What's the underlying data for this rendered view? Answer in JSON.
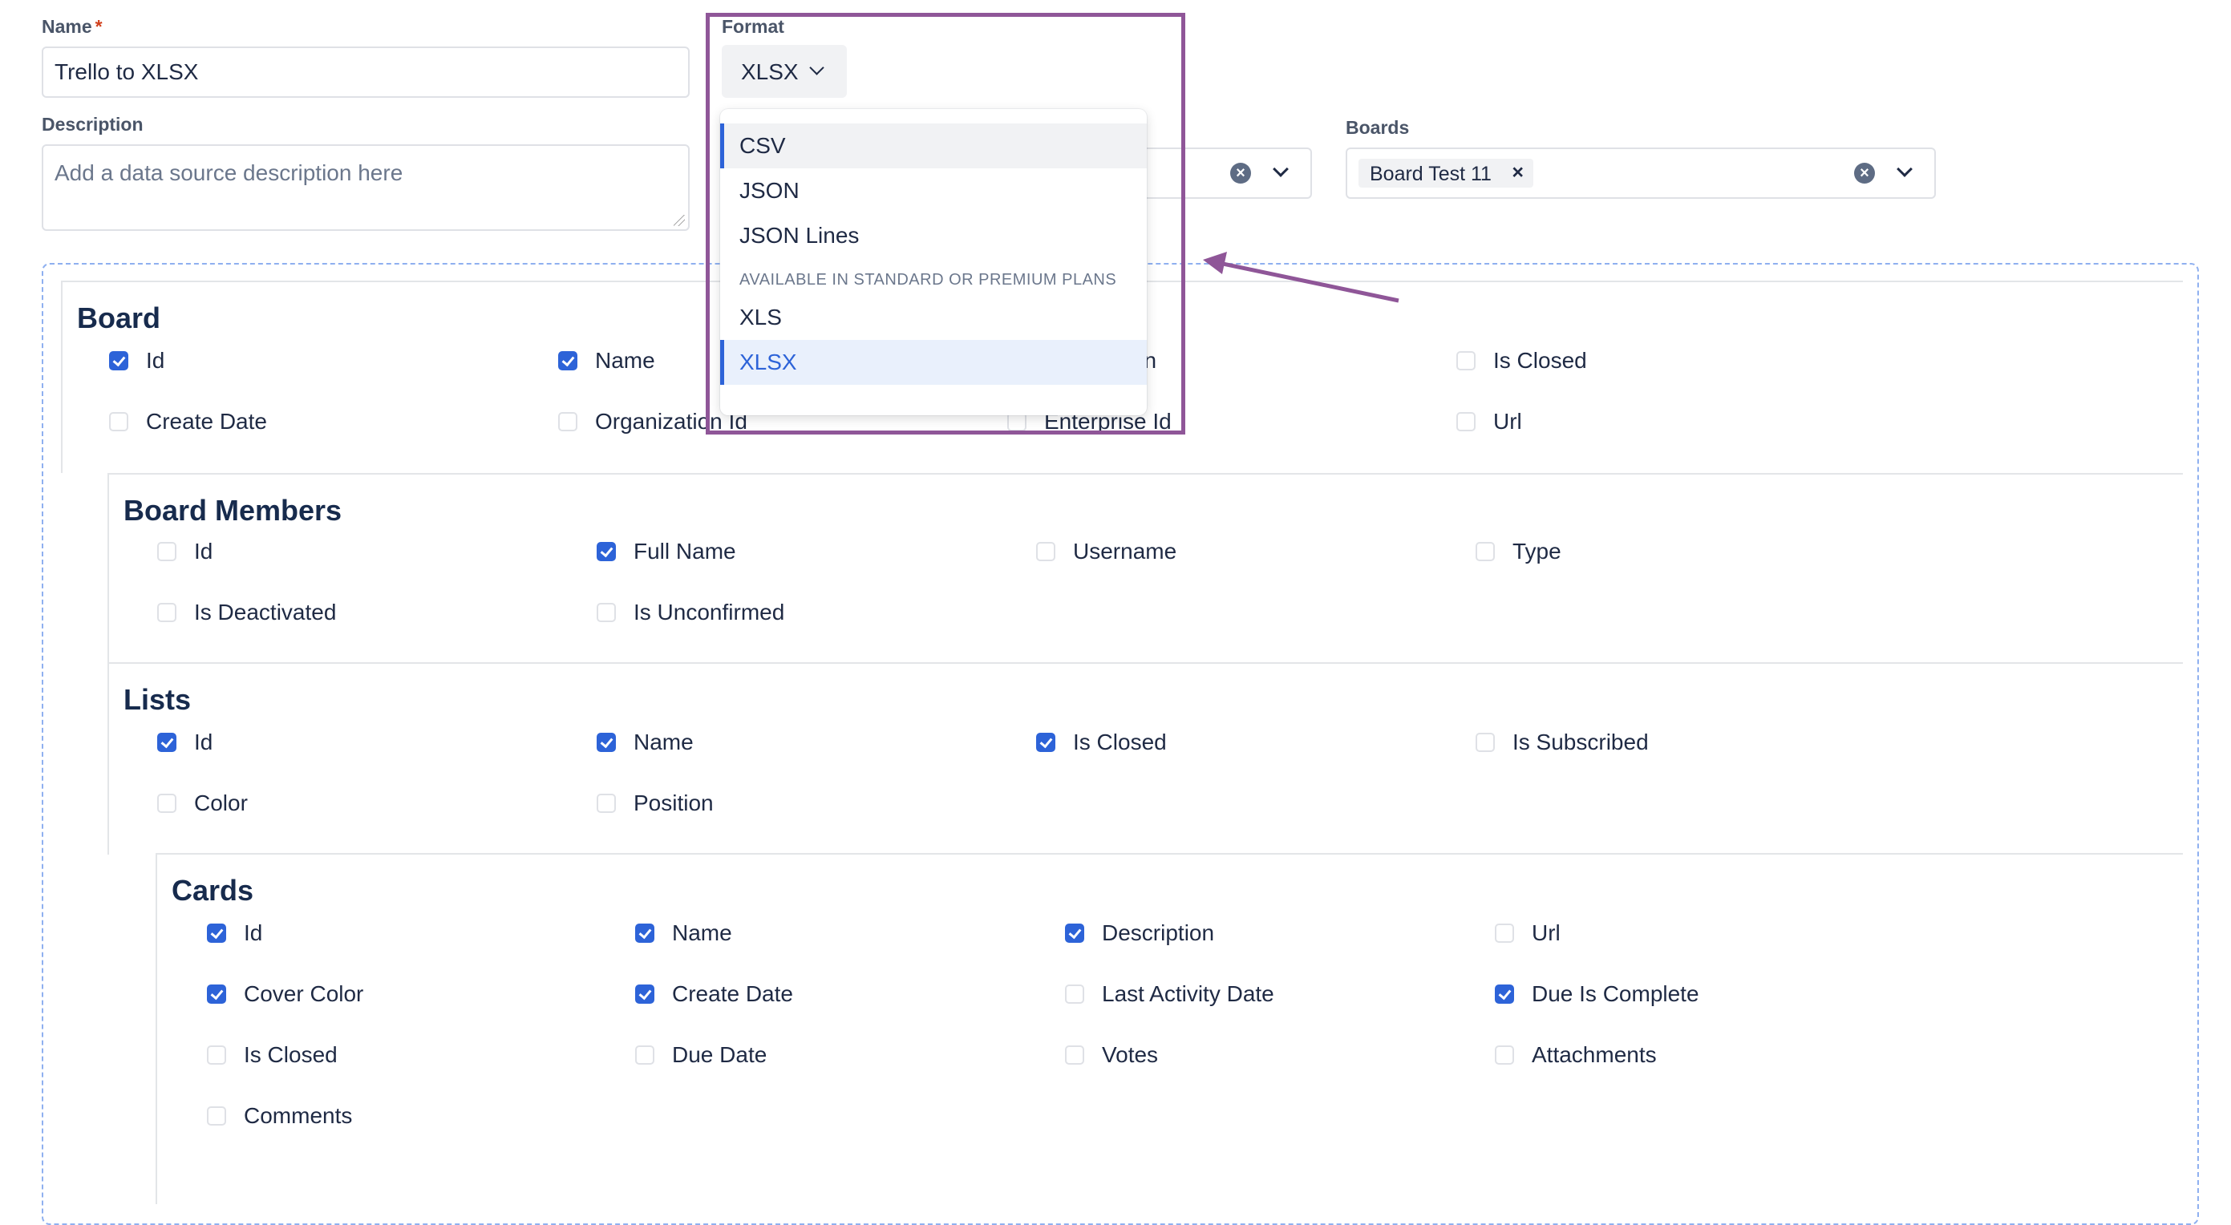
{
  "form": {
    "name_label": "Name",
    "name_required_marker": "*",
    "name_value": "Trello to XLSX",
    "description_label": "Description",
    "description_placeholder": "Add a data source description here",
    "format_label": "Format",
    "format_value": "XLSX",
    "boards_label": "Boards",
    "boards_tags": [
      "Board Test 11"
    ]
  },
  "format_dropdown": {
    "options": [
      {
        "label": "CSV",
        "state": "hover"
      },
      {
        "label": "JSON",
        "state": ""
      },
      {
        "label": "JSON Lines",
        "state": ""
      }
    ],
    "group_header": "AVAILABLE IN STANDARD OR PREMIUM PLANS",
    "premium_options": [
      {
        "label": "XLS",
        "state": ""
      },
      {
        "label": "XLSX",
        "state": "selected"
      }
    ]
  },
  "icons": {
    "clear": "×",
    "tag_remove": "×"
  },
  "colors": {
    "accent": "#2d63d8",
    "annotation": "#8f5698",
    "required": "#d1401c"
  },
  "sections": [
    {
      "title": "Board",
      "fields": [
        {
          "label": "Id",
          "checked": true
        },
        {
          "label": "Name",
          "checked": true
        },
        {
          "label": "Description",
          "checked": false
        },
        {
          "label": "Is Closed",
          "checked": false
        },
        {
          "label": "Create Date",
          "checked": false
        },
        {
          "label": "Organization Id",
          "checked": false
        },
        {
          "label": "Enterprise Id",
          "checked": false
        },
        {
          "label": "Url",
          "checked": false
        }
      ]
    },
    {
      "title": "Board Members",
      "fields": [
        {
          "label": "Id",
          "checked": false
        },
        {
          "label": "Full Name",
          "checked": true
        },
        {
          "label": "Username",
          "checked": false
        },
        {
          "label": "Type",
          "checked": false
        },
        {
          "label": "Is Deactivated",
          "checked": false
        },
        {
          "label": "Is Unconfirmed",
          "checked": false
        }
      ]
    },
    {
      "title": "Lists",
      "fields": [
        {
          "label": "Id",
          "checked": true
        },
        {
          "label": "Name",
          "checked": true
        },
        {
          "label": "Is Closed",
          "checked": true
        },
        {
          "label": "Is Subscribed",
          "checked": false
        },
        {
          "label": "Color",
          "checked": false
        },
        {
          "label": "Position",
          "checked": false
        }
      ]
    },
    {
      "title": "Cards",
      "fields": [
        {
          "label": "Id",
          "checked": true
        },
        {
          "label": "Name",
          "checked": true
        },
        {
          "label": "Description",
          "checked": true
        },
        {
          "label": "Url",
          "checked": false
        },
        {
          "label": "Cover Color",
          "checked": true
        },
        {
          "label": "Create Date",
          "checked": true
        },
        {
          "label": "Last Activity Date",
          "checked": false
        },
        {
          "label": "Due Is Complete",
          "checked": true
        },
        {
          "label": "Is Closed",
          "checked": false
        },
        {
          "label": "Due Date",
          "checked": false
        },
        {
          "label": "Votes",
          "checked": false
        },
        {
          "label": "Attachments",
          "checked": false
        },
        {
          "label": "Comments",
          "checked": false
        }
      ]
    }
  ]
}
